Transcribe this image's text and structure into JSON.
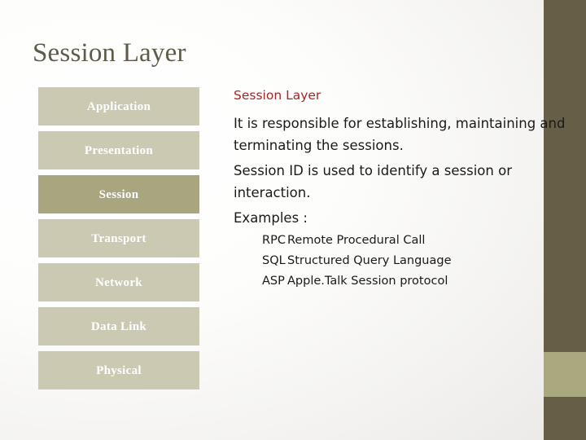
{
  "slide": {
    "title": "Session Layer"
  },
  "osi_stack": {
    "layers": [
      {
        "label": "Application",
        "highlighted": false
      },
      {
        "label": "Presentation",
        "highlighted": false
      },
      {
        "label": "Session",
        "highlighted": true
      },
      {
        "label": "Transport",
        "highlighted": false
      },
      {
        "label": "Network",
        "highlighted": false
      },
      {
        "label": "Data Link",
        "highlighted": false
      },
      {
        "label": "Physical",
        "highlighted": false
      }
    ]
  },
  "content": {
    "heading": "Session Layer",
    "paragraphs": [
      "It is responsible for establishing, maintaining and terminating the sessions.",
      "Session ID is used to identify a session or interaction."
    ],
    "examples_label": "Examples :",
    "examples": [
      {
        "abbr": "RPC",
        "desc": "Remote Procedural Call"
      },
      {
        "abbr": "SQL",
        "desc": "Structured Query Language"
      },
      {
        "abbr": "ASP",
        "desc": "Apple.Talk Session protocol"
      }
    ]
  },
  "colors": {
    "title_text": "#5F5B4B",
    "heading_red": "#A52626",
    "layer_default": "#CBC9B2",
    "layer_highlight": "#A8A57F",
    "edge_bar_dark": "#665E47",
    "edge_bar_accent": "#AAA87E",
    "body_text": "#1A1A1A"
  }
}
